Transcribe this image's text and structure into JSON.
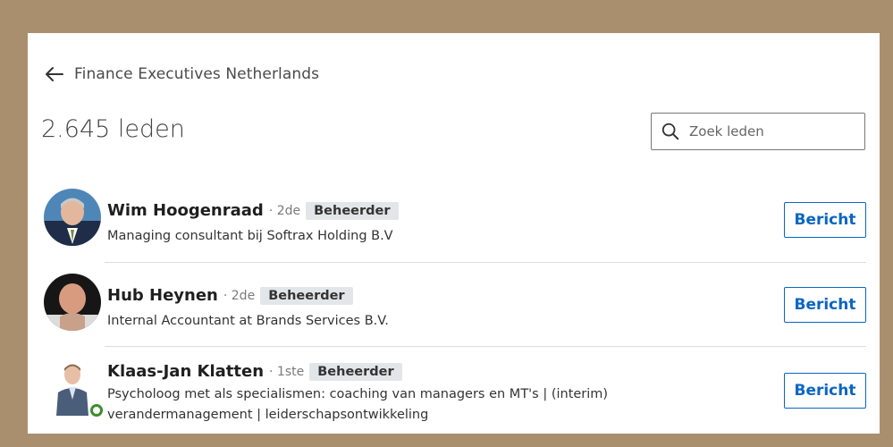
{
  "header": {
    "back_label": "Finance Executives Netherlands",
    "member_count": "2.645 leden"
  },
  "search": {
    "placeholder": "Zoek leden"
  },
  "members": [
    {
      "name": "Wim Hoogenraad",
      "degree": "· 2de",
      "badge": "Beheerder",
      "headline": "Managing consultant bij Softrax Holding B.V",
      "button": "Bericht",
      "online": false
    },
    {
      "name": "Hub Heynen",
      "degree": "· 2de",
      "badge": "Beheerder",
      "headline": "Internal Accountant at Brands Services B.V.",
      "button": "Bericht",
      "online": false
    },
    {
      "name": "Klaas-Jan Klatten",
      "degree": "· 1ste",
      "badge": "Beheerder",
      "headline": "Psycholoog met als specialismen: coaching van managers en MT's | (interim) verandermanagement | leiderschapsontwikkeling",
      "button": "Bericht",
      "online": true
    }
  ],
  "colors": {
    "accent": "#0a66c2",
    "frame": "#a98f6e",
    "badge_bg": "#e3e6e8",
    "online": "#3a8f2a"
  }
}
